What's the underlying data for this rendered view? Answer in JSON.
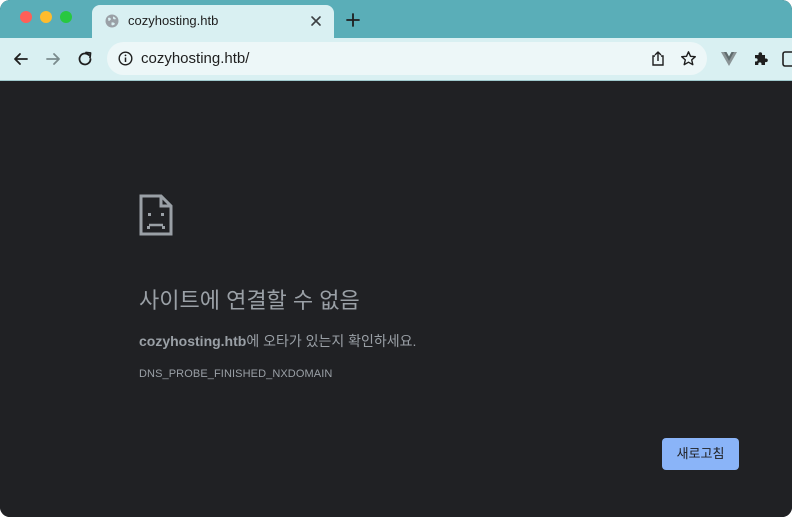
{
  "browser": {
    "tab": {
      "title": "cozyhosting.htb"
    },
    "omnibox": {
      "url": "cozyhosting.htb/"
    }
  },
  "error_page": {
    "title": "사이트에 연결할 수 없음",
    "description_host": "cozyhosting.htb",
    "description_rest": "에 오타가 있는지 확인하세요.",
    "error_code": "DNS_PROBE_FINISHED_NXDOMAIN",
    "reload_label": "새로고침"
  },
  "colors": {
    "tabstrip_bg": "#5aaeb8",
    "toolbar_bg": "#d9f0f2",
    "content_bg": "#202124",
    "text_muted": "#9aa0a6",
    "button_bg": "#8ab4f8"
  },
  "icons": {
    "traffic_lights": [
      "close-dot",
      "minimize-dot",
      "zoom-dot"
    ],
    "tab": [
      "globe-icon",
      "close-icon"
    ],
    "toolbar": [
      "back-arrow-icon",
      "forward-arrow-icon",
      "reload-icon",
      "info-icon",
      "share-icon",
      "star-icon",
      "vuejs-extension-icon",
      "puzzle-extensions-icon",
      "side-panel-icon"
    ],
    "content": [
      "sad-document-icon"
    ]
  }
}
